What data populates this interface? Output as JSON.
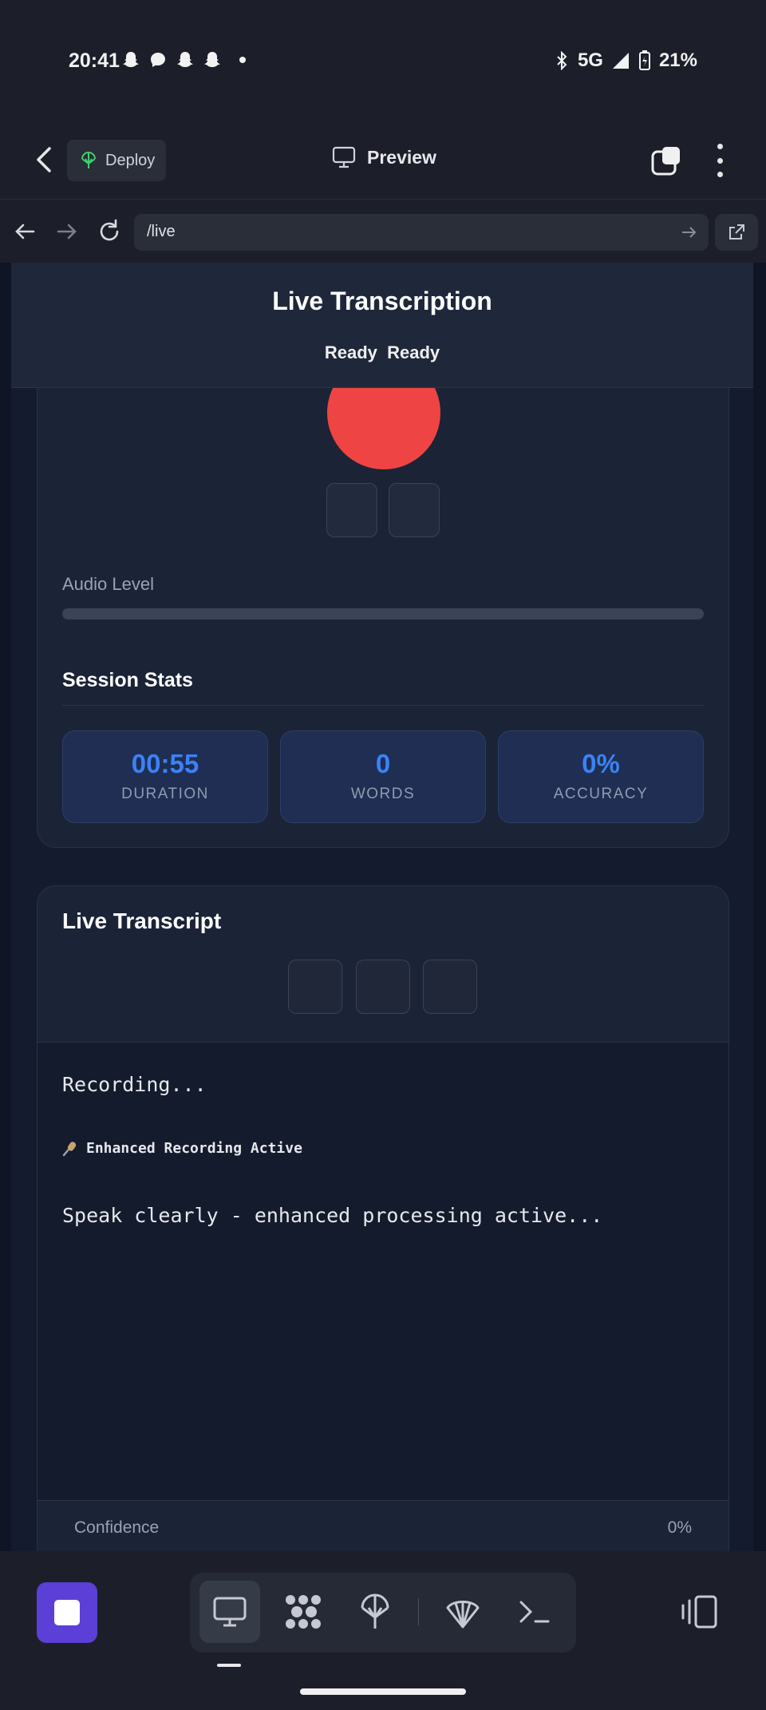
{
  "status_bar": {
    "time": "20:41",
    "network": "5G",
    "battery": "21%",
    "left_icons": [
      "snapchat-icon",
      "messenger-icon",
      "snapchat-icon",
      "snapchat-icon"
    ]
  },
  "app_bar": {
    "deploy_label": "Deploy",
    "preview_label": "Preview"
  },
  "browser": {
    "url": "/live"
  },
  "page": {
    "title": "Live Transcription",
    "status_text": "Ready  Ready",
    "audio_level_label": "Audio Level",
    "audio_level": 0,
    "session_stats_title": "Session Stats",
    "stats": [
      {
        "value": "00:55",
        "label": "DURATION"
      },
      {
        "value": "0",
        "label": "WORDS"
      },
      {
        "value": "0%",
        "label": "ACCURACY"
      }
    ],
    "transcript_title": "Live Transcript",
    "transcript": {
      "line1": "Recording...",
      "badge": "Enhanced Recording Active",
      "line3": "Speak clearly - enhanced processing active..."
    },
    "confidence_label": "Confidence",
    "confidence_value": "0%"
  },
  "colors": {
    "record": "#ef4444",
    "accent_blue": "#3b82f6",
    "stop_button": "#5b3fd6"
  }
}
